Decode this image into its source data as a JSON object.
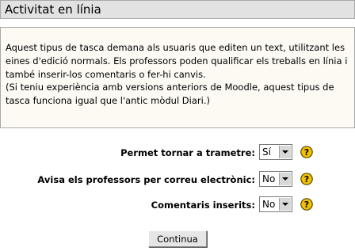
{
  "header": {
    "title": "Activitat en línia"
  },
  "description": {
    "paragraph_1": [
      "Aquest tipus de tasca demana als usuaris que editen un text, utilitzant les",
      "eines d'edició normals. Els professors poden qualificar els treballs en línia i",
      "també inserir-los comentaris o fer-hi canvis."
    ],
    "paragraph_2": [
      "(Si teniu experiència amb versions anteriors de Moodle, aquest tipus de",
      "tasca funciona igual que l'antic mòdul Diari.)"
    ]
  },
  "form": {
    "fields": [
      {
        "label": "Permet tornar a trametre:",
        "value": "Sí"
      },
      {
        "label": "Avisa els professors per correu electrònic:",
        "value": "No"
      },
      {
        "label": "Comentaris inserits:",
        "value": "No"
      }
    ],
    "help_icon": "question-mark-help-icon",
    "submit_label": "Continua"
  },
  "colors": {
    "title_bar_bg": "#e2e2e2",
    "description_bg": "#fcfaf3",
    "border": "#a8a8a8",
    "help_icon_fill": "#f2c200"
  }
}
